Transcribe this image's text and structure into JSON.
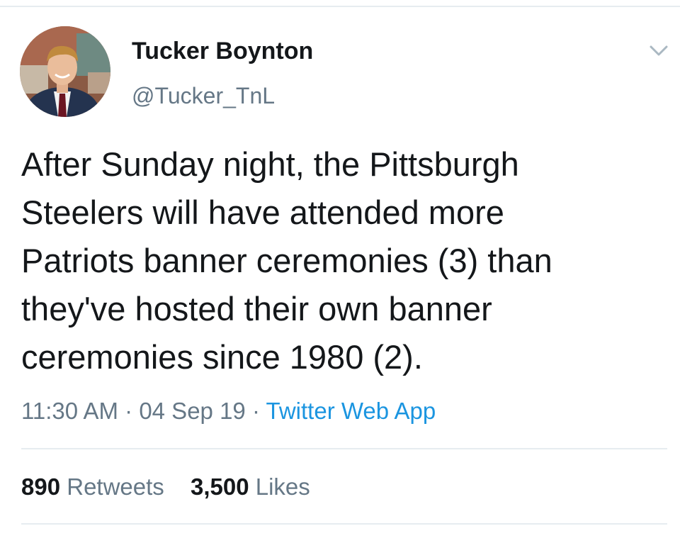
{
  "author": {
    "display_name": "Tucker Boynton",
    "handle": "@Tucker_TnL",
    "avatar_icon": "profile-photo"
  },
  "menu_icon": "chevron-down-icon",
  "tweet": {
    "text": "After Sunday night, the Pittsburgh\nSteelers will have attended more\nPatriots banner ceremonies (3) than\nthey've hosted their own banner\nceremonies since 1980 (2).",
    "time": "11:30 AM",
    "separator": " · ",
    "date": "04 Sep 19",
    "source": "Twitter Web App"
  },
  "stats": {
    "retweets_count": "890",
    "retweets_label": "Retweets",
    "likes_count": "3,500",
    "likes_label": "Likes"
  },
  "colors": {
    "text": "#14171a",
    "secondary": "#657786",
    "link": "#1b95e0",
    "divider": "#e6ecf0"
  }
}
